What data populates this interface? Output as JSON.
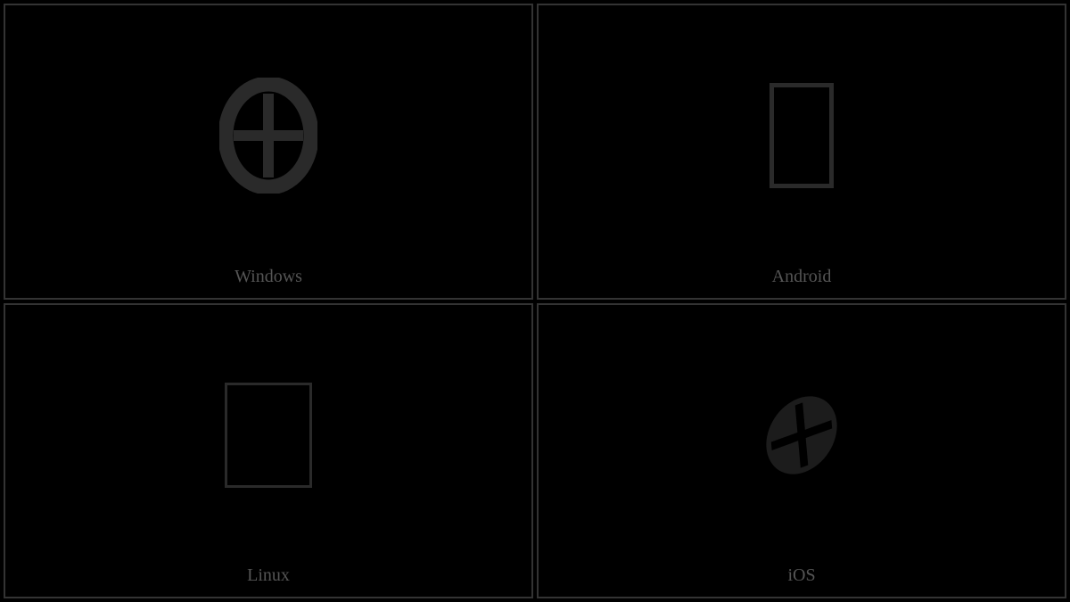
{
  "cells": [
    {
      "label": "Windows",
      "glyph": "windows-circle-plus"
    },
    {
      "label": "Android",
      "glyph": "empty-rect"
    },
    {
      "label": "Linux",
      "glyph": "empty-rect"
    },
    {
      "label": "iOS",
      "glyph": "ios-oblique-circle-plus"
    }
  ]
}
